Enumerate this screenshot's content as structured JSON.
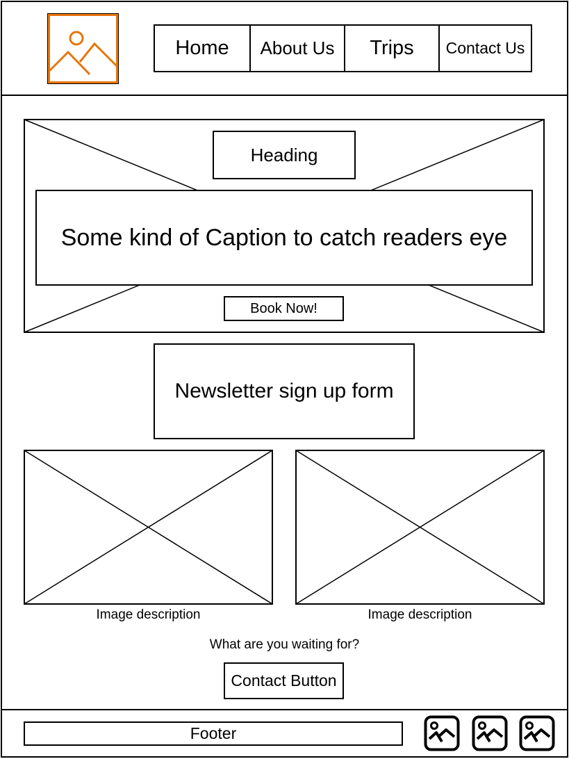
{
  "header": {
    "logo_icon": "image-placeholder-icon",
    "nav": [
      {
        "label": "Home"
      },
      {
        "label": "About Us"
      },
      {
        "label": "Trips"
      },
      {
        "label": "Contact Us"
      }
    ]
  },
  "hero": {
    "heading": "Heading",
    "caption": "Some kind of Caption to catch readers eye",
    "cta": "Book Now!"
  },
  "newsletter": {
    "label": "Newsletter sign up form"
  },
  "gallery": [
    {
      "description": "Image description"
    },
    {
      "description": "Image description"
    }
  ],
  "cta_section": {
    "prompt": "What are you waiting for?",
    "button": "Contact Button"
  },
  "footer": {
    "label": "Footer",
    "social_icons": [
      "image-icon",
      "image-icon",
      "image-icon"
    ]
  },
  "colors": {
    "logo_accent": "#E8750C",
    "stroke": "#000000"
  }
}
